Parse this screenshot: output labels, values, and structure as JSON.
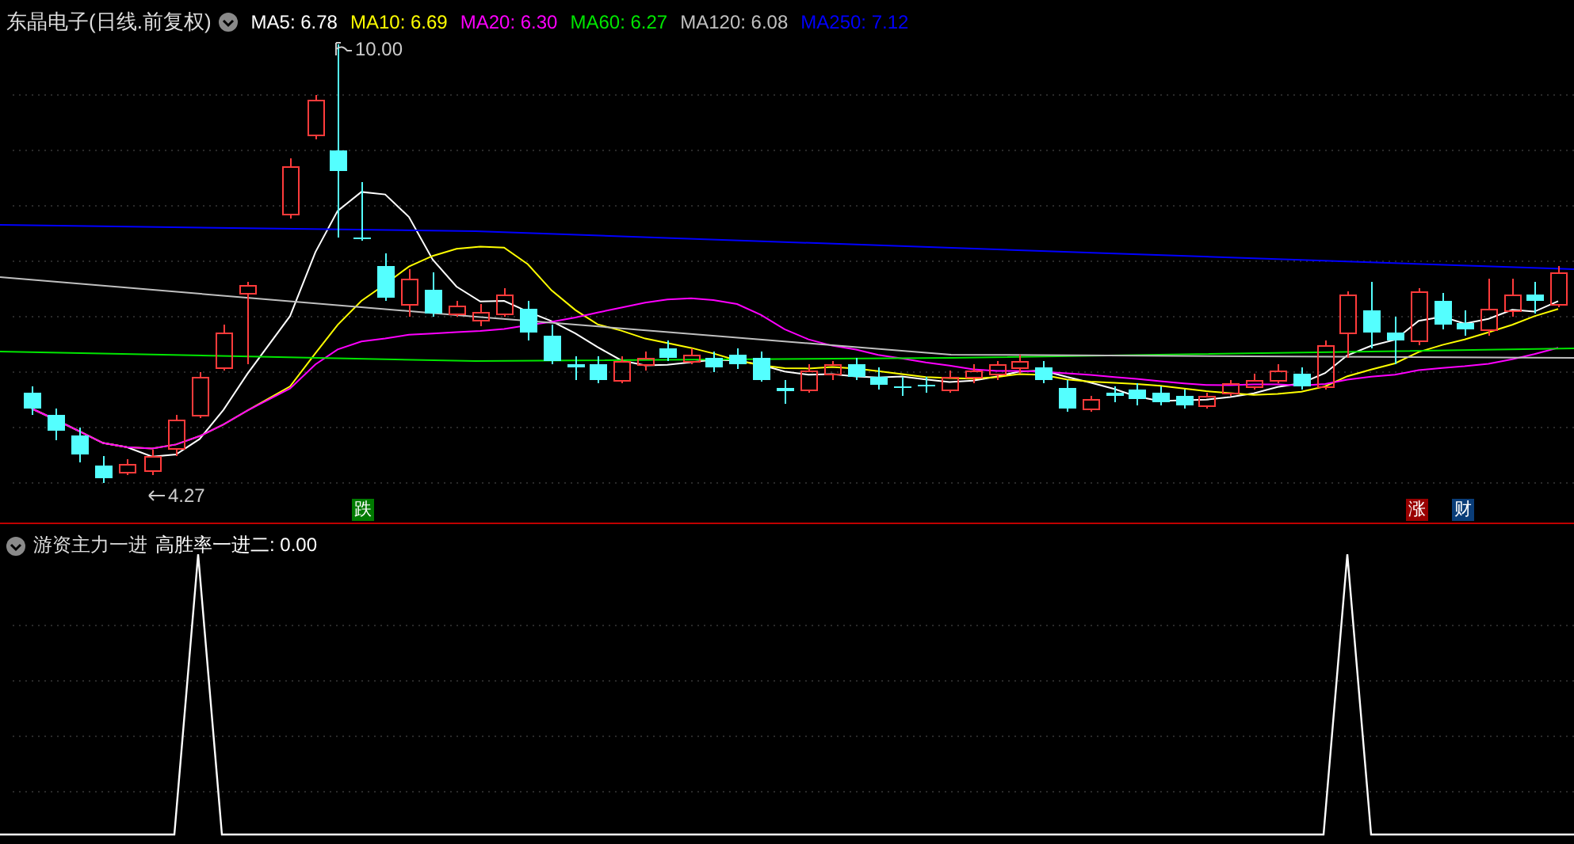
{
  "header": {
    "title": "东晶电子(日线.前复权)",
    "indicators": [
      {
        "label": "MA5: 6.78",
        "color": "#ffffff"
      },
      {
        "label": "MA10: 6.69",
        "color": "#ffff00"
      },
      {
        "label": "MA20: 6.30",
        "color": "#ff00ff"
      },
      {
        "label": "MA60: 6.27",
        "color": "#00e600"
      },
      {
        "label": "MA120: 6.08",
        "color": "#c0c0c0"
      },
      {
        "label": "MA250: 7.12",
        "color": "#0000ff"
      }
    ]
  },
  "price_labels": [
    {
      "kind": "high",
      "text": "10.00"
    },
    {
      "kind": "low",
      "text": "4.27"
    }
  ],
  "markers": [
    {
      "text": "跌",
      "color": "#007a00"
    },
    {
      "text": "涨",
      "color": "#990000"
    },
    {
      "text": "财",
      "color": "#0a3d78"
    }
  ],
  "indicator_panel": {
    "title": "游资主力一进",
    "value": "高胜率一进二: 0.00"
  }
}
